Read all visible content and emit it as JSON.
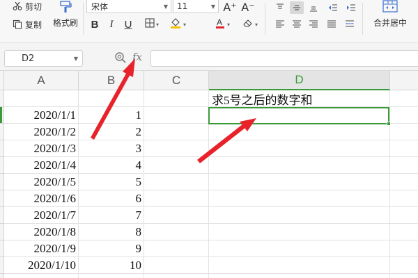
{
  "ribbon": {
    "cut_label": "剪切",
    "copy_label": "复制",
    "format_painter_label": "格式刷",
    "font_name": "宋体",
    "font_size": "11",
    "bold_label": "B",
    "italic_label": "I",
    "underline_label": "U",
    "grow_font_label": "A⁺",
    "shrink_font_label": "A⁻",
    "merge_center_label": "合并居中",
    "icons": [
      "scissors-icon",
      "copy-icon",
      "format-painter-icon",
      "border-icon",
      "fill-color-icon",
      "font-color-icon",
      "clear-icon",
      "align-top-icon",
      "align-middle-icon",
      "align-bottom-icon",
      "indent-decrease-icon",
      "indent-increase-icon",
      "align-left-icon",
      "align-center-icon",
      "align-right-icon",
      "justify-icon",
      "distributed-icon",
      "merge-center-icon"
    ],
    "accent_red": "#e0262a"
  },
  "formula_bar": {
    "name_box": "D2",
    "fx_label": "fx",
    "formula": ""
  },
  "grid": {
    "columns": [
      "A",
      "B",
      "C",
      "D"
    ],
    "selected_column": "D",
    "active_cell": "D2",
    "accent_green": "#3a9a3a",
    "rows": [
      {
        "a": "",
        "b": "",
        "d": "求5号之后的数字和"
      },
      {
        "a": "2020/1/1",
        "b": "1",
        "d": ""
      },
      {
        "a": "2020/1/2",
        "b": "2",
        "d": ""
      },
      {
        "a": "2020/1/3",
        "b": "3",
        "d": ""
      },
      {
        "a": "2020/1/4",
        "b": "4",
        "d": ""
      },
      {
        "a": "2020/1/5",
        "b": "5",
        "d": ""
      },
      {
        "a": "2020/1/6",
        "b": "6",
        "d": ""
      },
      {
        "a": "2020/1/7",
        "b": "7",
        "d": ""
      },
      {
        "a": "2020/1/8",
        "b": "8",
        "d": ""
      },
      {
        "a": "2020/1/9",
        "b": "9",
        "d": ""
      },
      {
        "a": "2020/1/10",
        "b": "10",
        "d": ""
      }
    ]
  },
  "annotations": {
    "arrow_color": "#e8222a",
    "arrows": [
      "arrow-to-fx",
      "arrow-to-d2"
    ]
  }
}
